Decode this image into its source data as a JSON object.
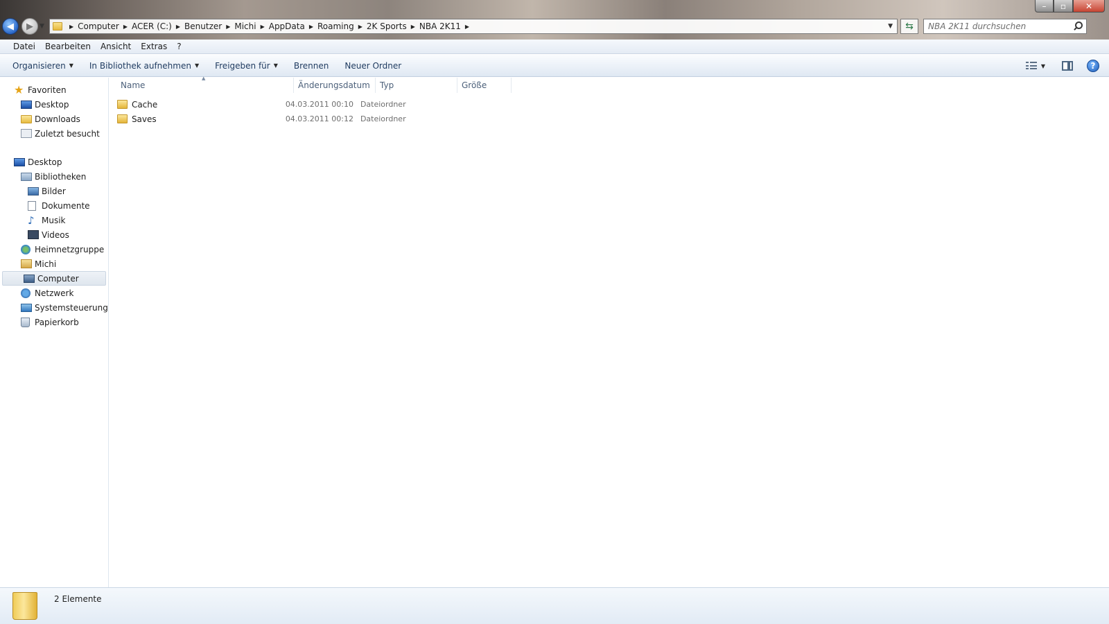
{
  "window": {
    "controls": {
      "minimize": "–",
      "maximize": "▫",
      "close": "✕"
    }
  },
  "navigation": {
    "back_icon": "arrow-left-icon",
    "forward_icon": "arrow-right-icon",
    "breadcrumbs": [
      "Computer",
      "ACER (C:)",
      "Benutzer",
      "Michi",
      "AppData",
      "Roaming",
      "2K Sports",
      "NBA 2K11"
    ],
    "refresh_icon": "refresh-icon",
    "search_placeholder": "NBA 2K11 durchsuchen"
  },
  "menubar": {
    "items": [
      "Datei",
      "Bearbeiten",
      "Ansicht",
      "Extras",
      "?"
    ]
  },
  "commandbar": {
    "organize": "Organisieren",
    "include_library": "In Bibliothek aufnehmen",
    "share": "Freigeben für",
    "burn": "Brennen",
    "new_folder": "Neuer Ordner",
    "help": "?"
  },
  "navpane": {
    "favorites": "Favoriten",
    "fav_items": [
      "Desktop",
      "Downloads",
      "Zuletzt besucht"
    ],
    "desktop": "Desktop",
    "libraries": "Bibliotheken",
    "lib_items": [
      "Bilder",
      "Dokumente",
      "Musik",
      "Videos"
    ],
    "homegroup": "Heimnetzgruppe",
    "user": "Michi",
    "computer": "Computer",
    "network": "Netzwerk",
    "control_panel": "Systemsteuerung",
    "recycle_bin": "Papierkorb"
  },
  "filelist": {
    "columns": {
      "name": "Name",
      "date": "Änderungsdatum",
      "type": "Typ",
      "size": "Größe"
    },
    "rows": [
      {
        "name": "Cache",
        "date": "04.03.2011 00:10",
        "type": "Dateiordner"
      },
      {
        "name": "Saves",
        "date": "04.03.2011 00:12",
        "type": "Dateiordner"
      }
    ]
  },
  "status": {
    "item_count": "2 Elemente"
  },
  "colors": {
    "accent": "#1e3a5f",
    "selection": "#dfe6ee"
  }
}
